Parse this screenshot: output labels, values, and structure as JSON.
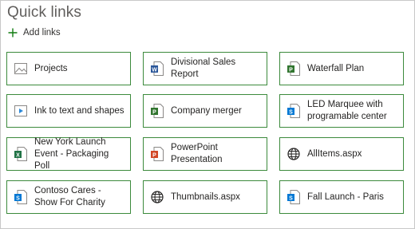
{
  "header": {
    "title": "Quick links",
    "add_label": "Add links"
  },
  "colors": {
    "tile_border": "#3c8a3c",
    "add_plus": "#107c10"
  },
  "links": [
    {
      "label": "Projects",
      "icon": "image-icon"
    },
    {
      "label": "Divisional Sales Report",
      "icon": "word-doc-icon"
    },
    {
      "label": "Waterfall Plan",
      "icon": "project-icon"
    },
    {
      "label": "Ink to text and shapes",
      "icon": "video-icon"
    },
    {
      "label": "Company merger",
      "icon": "project-icon"
    },
    {
      "label": "LED Marquee with programable center",
      "icon": "sharepoint-icon"
    },
    {
      "label": "New York Launch Event - Packaging Poll",
      "icon": "excel-icon"
    },
    {
      "label": "PowerPoint Presentation",
      "icon": "powerpoint-icon"
    },
    {
      "label": "AllItems.aspx",
      "icon": "globe-icon"
    },
    {
      "label": "Contoso Cares - Show For Charity",
      "icon": "sharepoint-icon"
    },
    {
      "label": "Thumbnails.aspx",
      "icon": "globe-icon"
    },
    {
      "label": "Fall Launch - Paris",
      "icon": "sharepoint-icon"
    }
  ]
}
